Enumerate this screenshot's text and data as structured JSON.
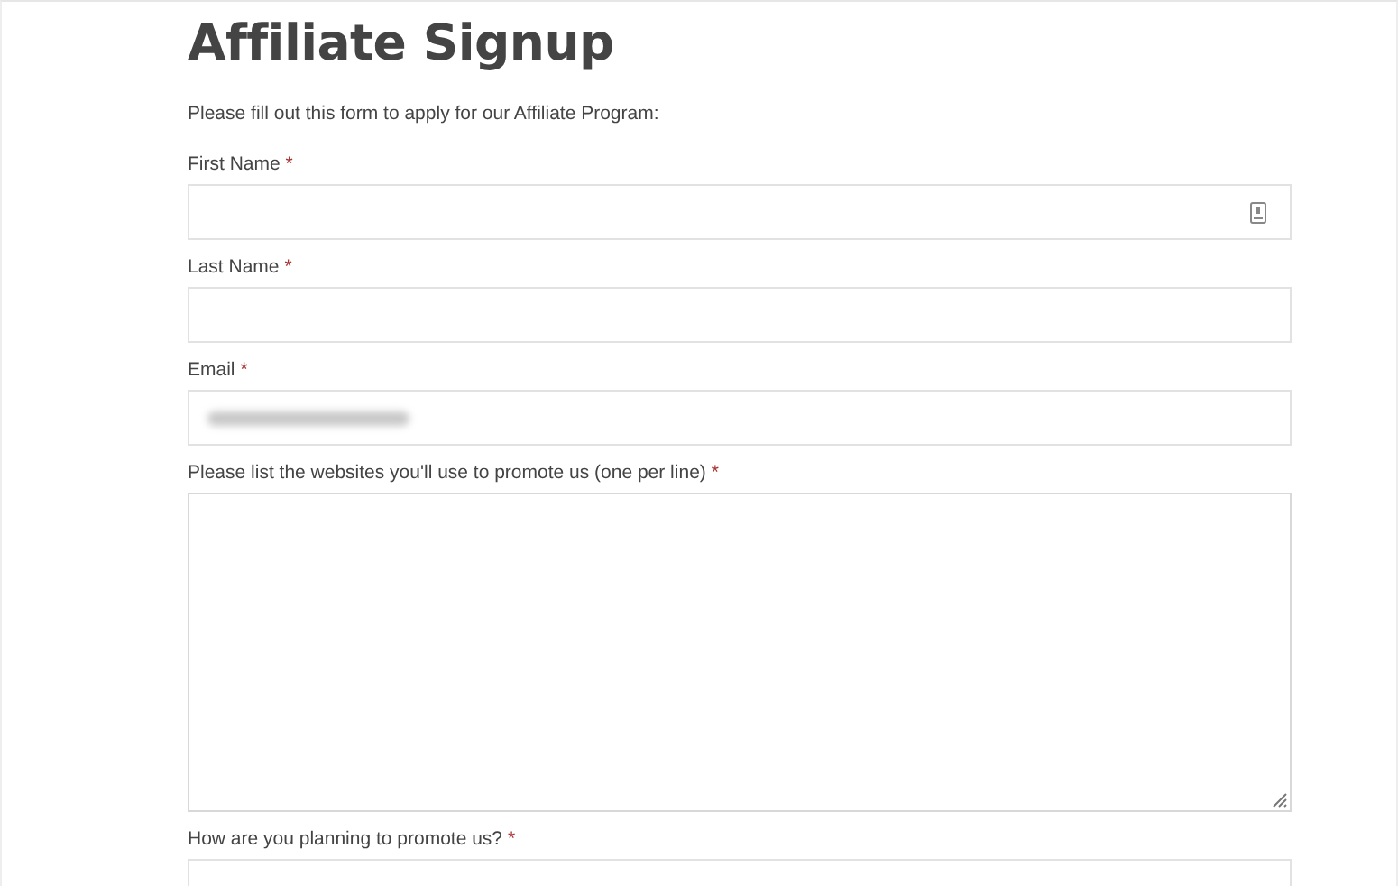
{
  "title": "Affiliate Signup",
  "intro": "Please fill out this form to apply for our Affiliate Program:",
  "fields": [
    {
      "label": "First Name",
      "required_mark": "*",
      "kind": "input",
      "autofill_icon": true
    },
    {
      "label": "Last Name",
      "required_mark": "*",
      "kind": "input"
    },
    {
      "label": "Email",
      "required_mark": "*",
      "kind": "input",
      "redacted_value": true
    },
    {
      "label": "Please list the websites you'll use to promote us (one per line)",
      "required_mark": "*",
      "kind": "textarea"
    },
    {
      "label": "How are you planning to promote us?",
      "required_mark": "*",
      "kind": "input"
    }
  ]
}
